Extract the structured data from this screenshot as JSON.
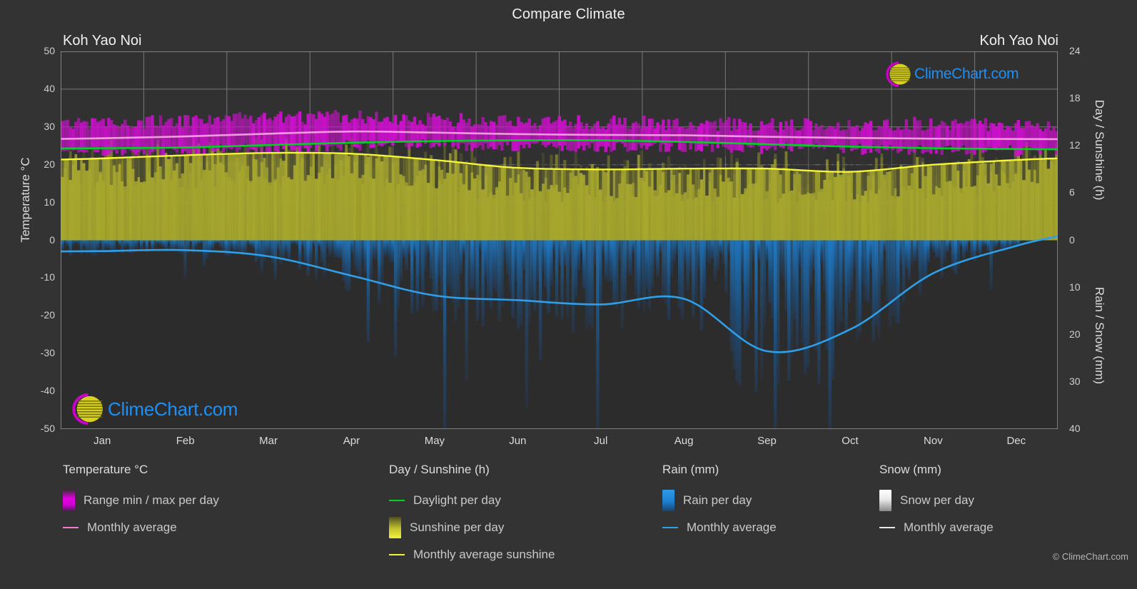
{
  "title": "Compare Climate",
  "locations": {
    "left": "Koh Yao Noi",
    "right": "Koh Yao Noi"
  },
  "axes": {
    "left_title": "Temperature °C",
    "right_title_top": "Day / Sunshine (h)",
    "right_title_bottom": "Rain / Snow (mm)",
    "left_ticks": [
      "50",
      "40",
      "30",
      "20",
      "10",
      "0",
      "-10",
      "-20",
      "-30",
      "-40",
      "-50"
    ],
    "right_ticks_top": [
      "24",
      "18",
      "12",
      "6",
      "0"
    ],
    "right_ticks_bottom": [
      "0",
      "10",
      "20",
      "30",
      "40"
    ],
    "x_ticks": [
      "Jan",
      "Feb",
      "Mar",
      "Apr",
      "May",
      "Jun",
      "Jul",
      "Aug",
      "Sep",
      "Oct",
      "Nov",
      "Dec"
    ]
  },
  "legend": {
    "temperature": {
      "heading": "Temperature °C",
      "items": [
        {
          "label": "Range min / max per day",
          "swatch": "gradient",
          "color": "#e400e4"
        },
        {
          "label": "Monthly average",
          "swatch": "line",
          "color": "#f07ad0"
        }
      ]
    },
    "day_sunshine": {
      "heading": "Day / Sunshine (h)",
      "items": [
        {
          "label": "Daylight per day",
          "swatch": "line",
          "color": "#00d421"
        },
        {
          "label": "Sunshine per day",
          "swatch": "gradient",
          "color": "#f2f23c"
        },
        {
          "label": "Monthly average sunshine",
          "swatch": "line",
          "color": "#f2f23c"
        }
      ]
    },
    "rain": {
      "heading": "Rain (mm)",
      "items": [
        {
          "label": "Rain per day",
          "swatch": "gradient",
          "color": "#1e8ae0"
        },
        {
          "label": "Monthly average",
          "swatch": "line",
          "color": "#2f9fe8"
        }
      ]
    },
    "snow": {
      "heading": "Snow (mm)",
      "items": [
        {
          "label": "Snow per day",
          "swatch": "gradient",
          "color": "#ffffff"
        },
        {
          "label": "Monthly average",
          "swatch": "line",
          "color": "#e8e8e8"
        }
      ]
    }
  },
  "watermark": {
    "text": "ClimeChart.com"
  },
  "copyright": "© ClimeChart.com",
  "chart_data": {
    "type": "area",
    "title": "Compare Climate",
    "subtitle": "Koh Yao Noi",
    "xlabel": "",
    "ylabel": "Temperature °C",
    "ylim": [
      -50,
      50
    ],
    "y2_top_label": "Day / Sunshine (h)",
    "y2_top_lim": [
      0,
      24
    ],
    "y2_bottom_label": "Rain / Snow (mm)",
    "y2_bottom_lim": [
      0,
      40
    ],
    "grid": true,
    "legend_position": "below",
    "categories": [
      "Jan",
      "Feb",
      "Mar",
      "Apr",
      "May",
      "Jun",
      "Jul",
      "Aug",
      "Sep",
      "Oct",
      "Nov",
      "Dec"
    ],
    "series": [
      {
        "name": "Monthly average temperature (°C)",
        "values": [
          27.0,
          27.5,
          28.2,
          28.8,
          28.5,
          28.1,
          27.9,
          27.8,
          27.4,
          27.1,
          26.9,
          26.8
        ]
      },
      {
        "name": "Daily max temperature (°C)",
        "values": [
          31.0,
          31.6,
          32.2,
          32.6,
          32.0,
          31.4,
          31.2,
          31.0,
          30.6,
          30.6,
          30.8,
          30.6
        ]
      },
      {
        "name": "Daily min temperature (°C)",
        "values": [
          23.3,
          23.6,
          24.3,
          25.0,
          25.2,
          24.9,
          24.7,
          24.6,
          24.3,
          24.1,
          23.9,
          23.6
        ]
      },
      {
        "name": "Daylight per day (h)",
        "values": [
          11.7,
          11.8,
          12.1,
          12.4,
          12.6,
          12.7,
          12.7,
          12.5,
          12.2,
          11.9,
          11.7,
          11.6
        ]
      },
      {
        "name": "Monthly average sunshine (h)",
        "values": [
          10.4,
          10.8,
          11.1,
          11.0,
          10.2,
          9.2,
          9.0,
          9.1,
          9.1,
          8.7,
          9.6,
          10.2
        ]
      },
      {
        "name": "Monthly average rain (mm)",
        "values": [
          2.3,
          2.1,
          3.4,
          7.5,
          11.7,
          12.7,
          13.6,
          12.4,
          23.5,
          18.9,
          7.0,
          1.2
        ]
      },
      {
        "name": "Monthly average snow (mm)",
        "values": [
          0,
          0,
          0,
          0,
          0,
          0,
          0,
          0,
          0,
          0,
          0,
          0
        ]
      }
    ]
  }
}
